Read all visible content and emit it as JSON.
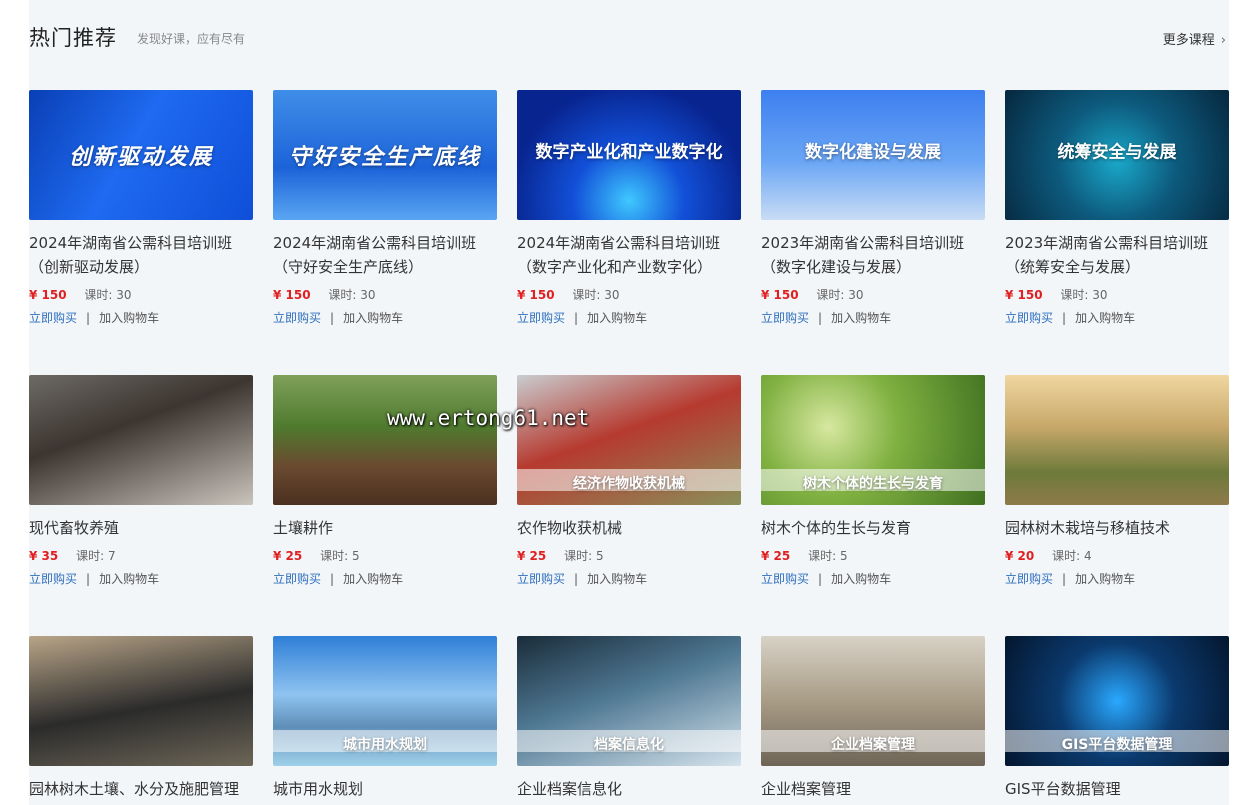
{
  "section": {
    "title": "热门推荐",
    "subtitle": "发现好课，应有尽有",
    "more_label": "更多课程"
  },
  "labels": {
    "buy": "立即购买",
    "cart": "加入购物车",
    "separator": "|",
    "hours_prefix": "课时:"
  },
  "courses": [
    {
      "title_line1": "2024年湖南省公需科目培训班",
      "title_line2": "（创新驱动发展）",
      "price": "¥ 150",
      "hours": "30",
      "thumb_text": "创新驱动发展",
      "thumb_style": "script"
    },
    {
      "title_line1": "2024年湖南省公需科目培训班",
      "title_line2": "（守好安全生产底线）",
      "price": "¥ 150",
      "hours": "30",
      "thumb_text": "守好安全生产底线",
      "thumb_style": "script"
    },
    {
      "title_line1": "2024年湖南省公需科目培训班",
      "title_line2": "（数字产业化和产业数字化）",
      "price": "¥ 150",
      "hours": "30",
      "thumb_text": "数字产业化和产业数字化",
      "thumb_style": "plain"
    },
    {
      "title_line1": "2023年湖南省公需科目培训班",
      "title_line2": "（数字化建设与发展）",
      "price": "¥ 150",
      "hours": "30",
      "thumb_text": "数字化建设与发展",
      "thumb_style": "plain"
    },
    {
      "title_line1": "2023年湖南省公需科目培训班",
      "title_line2": "（统筹安全与发展）",
      "price": "¥ 150",
      "hours": "30",
      "thumb_text": "统筹安全与发展",
      "thumb_style": "plain"
    },
    {
      "title_line1": "现代畜牧养殖",
      "title_line2": "",
      "price": "¥ 35",
      "hours": "7",
      "thumb_text": "",
      "thumb_style": "photo"
    },
    {
      "title_line1": "土壤耕作",
      "title_line2": "",
      "price": "¥ 25",
      "hours": "5",
      "thumb_text": "",
      "thumb_style": "photo"
    },
    {
      "title_line1": "农作物收获机械",
      "title_line2": "",
      "price": "¥ 25",
      "hours": "5",
      "thumb_text": "经济作物收获机械",
      "thumb_style": "banner"
    },
    {
      "title_line1": "树木个体的生长与发育",
      "title_line2": "",
      "price": "¥ 25",
      "hours": "5",
      "thumb_text": "树木个体的生长与发育",
      "thumb_style": "banner"
    },
    {
      "title_line1": "园林树木栽培与移植技术",
      "title_line2": "",
      "price": "¥ 20",
      "hours": "4",
      "thumb_text": "",
      "thumb_style": "photo"
    },
    {
      "title_line1": "园林树木土壤、水分及施肥管理",
      "title_line2": "",
      "price": "",
      "hours": "",
      "thumb_text": "",
      "thumb_style": "photo"
    },
    {
      "title_line1": "城市用水规划",
      "title_line2": "",
      "price": "",
      "hours": "",
      "thumb_text": "城市用水规划",
      "thumb_style": "banner"
    },
    {
      "title_line1": "企业档案信息化",
      "title_line2": "",
      "price": "",
      "hours": "",
      "thumb_text": "档案信息化",
      "thumb_style": "banner"
    },
    {
      "title_line1": "企业档案管理",
      "title_line2": "",
      "price": "",
      "hours": "",
      "thumb_text": "企业档案管理",
      "thumb_style": "banner"
    },
    {
      "title_line1": "GIS平台数据管理",
      "title_line2": "",
      "price": "",
      "hours": "",
      "thumb_text": "GIS平台数据管理",
      "thumb_style": "banner"
    }
  ],
  "watermark": "www.ertong61.net",
  "colors": {
    "price": "#e02020",
    "link": "#2f6fbd",
    "page_bg": "#f3f6f9"
  }
}
